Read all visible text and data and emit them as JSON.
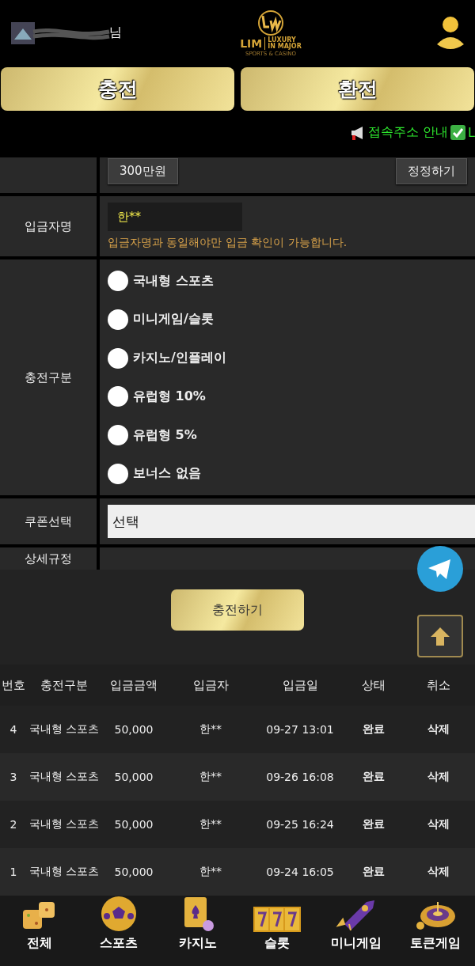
{
  "header": {
    "username_tail": "님",
    "logo": {
      "mark": "LIM",
      "tagline_1": "LUXURY",
      "tagline_2": "IN MAJOR",
      "subtitle": "SPORTS & CASINO"
    }
  },
  "main_tabs": [
    {
      "label": "충전"
    },
    {
      "label": "환전"
    }
  ],
  "ticker": {
    "text": "접속주소 안내",
    "tail": "L"
  },
  "form": {
    "amount_chip": "300만원",
    "reset_button": "정정하기",
    "depositor": {
      "label": "입금자명",
      "value": "한**",
      "note": "입금자명과 동일해야만 입금 확인이 가능합니다."
    },
    "bonus": {
      "label": "충전구분",
      "options": [
        {
          "label": "국내형 스포츠",
          "selected": false
        },
        {
          "label": "미니게임/슬롯",
          "selected": false
        },
        {
          "label": "카지노/인플레이",
          "selected": false
        },
        {
          "label": "유럽형 10%",
          "selected": false
        },
        {
          "label": "유럽형 5%",
          "selected": false
        },
        {
          "label": "보너스 없음",
          "selected": false
        }
      ]
    },
    "coupon": {
      "label": "쿠폰선택",
      "value": "선택"
    },
    "rules": {
      "label": "상세규정"
    },
    "submit": "충전하기"
  },
  "table": {
    "columns": [
      "번호",
      "충전구분",
      "입금금액",
      "입금자",
      "입금일",
      "상태",
      "취소"
    ],
    "rows": [
      [
        "4",
        "국내형 스포츠",
        "50,000",
        "한**",
        "09-27 13:01",
        "완료",
        "삭제"
      ],
      [
        "3",
        "국내형 스포츠",
        "50,000",
        "한**",
        "09-26 16:08",
        "완료",
        "삭제"
      ],
      [
        "2",
        "국내형 스포츠",
        "50,000",
        "한**",
        "09-25 16:24",
        "완료",
        "삭제"
      ],
      [
        "1",
        "국내형 스포츠",
        "50,000",
        "한**",
        "09-24 16:05",
        "완료",
        "삭제"
      ]
    ]
  },
  "bottom_nav": [
    {
      "label": "전체",
      "kind": "dice"
    },
    {
      "label": "스포츠",
      "kind": "ball"
    },
    {
      "label": "카지노",
      "kind": "cards"
    },
    {
      "label": "슬롯",
      "kind": "slot"
    },
    {
      "label": "미니게임",
      "kind": "rocket"
    },
    {
      "label": "토큰게임",
      "kind": "roulette"
    }
  ]
}
